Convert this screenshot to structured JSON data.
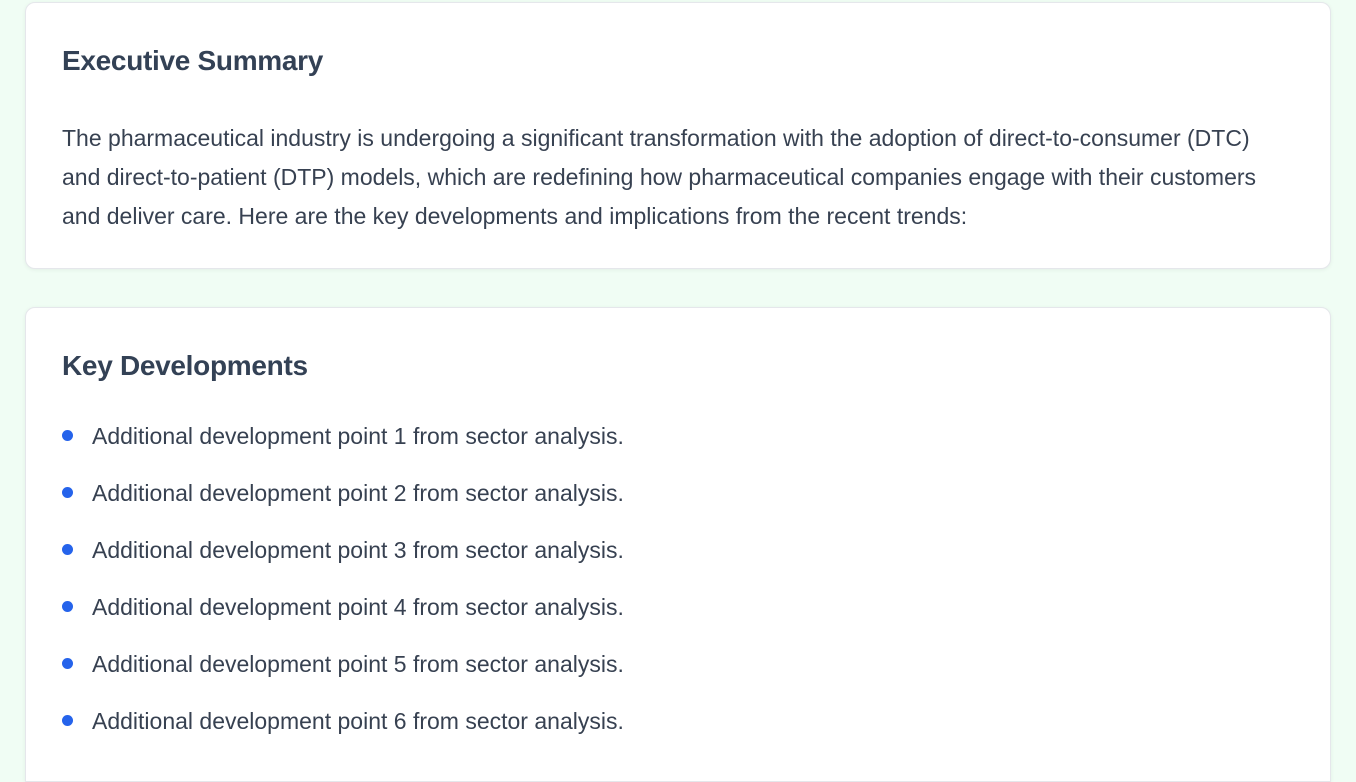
{
  "executive_summary": {
    "title": "Executive Summary",
    "text": "The pharmaceutical industry is undergoing a significant transformation with the adoption of direct-to-consumer (DTC) and direct-to-patient (DTP) models, which are redefining how pharmaceutical companies engage with their customers and deliver care. Here are the key developments and implications from the recent trends:"
  },
  "key_developments": {
    "title": "Key Developments",
    "items": [
      {
        "label": "Additional development point 1 from sector analysis."
      },
      {
        "label": "Additional development point 2 from sector analysis."
      },
      {
        "label": "Additional development point 3 from sector analysis."
      },
      {
        "label": "Additional development point 4 from sector analysis."
      },
      {
        "label": "Additional development point 5 from sector analysis."
      },
      {
        "label": "Additional development point 6 from sector analysis."
      }
    ]
  },
  "colors": {
    "page_background": "#f0fdf4",
    "card_background": "#ffffff",
    "heading": "#334155",
    "body_text": "#374151",
    "bullet": "#2563eb"
  }
}
